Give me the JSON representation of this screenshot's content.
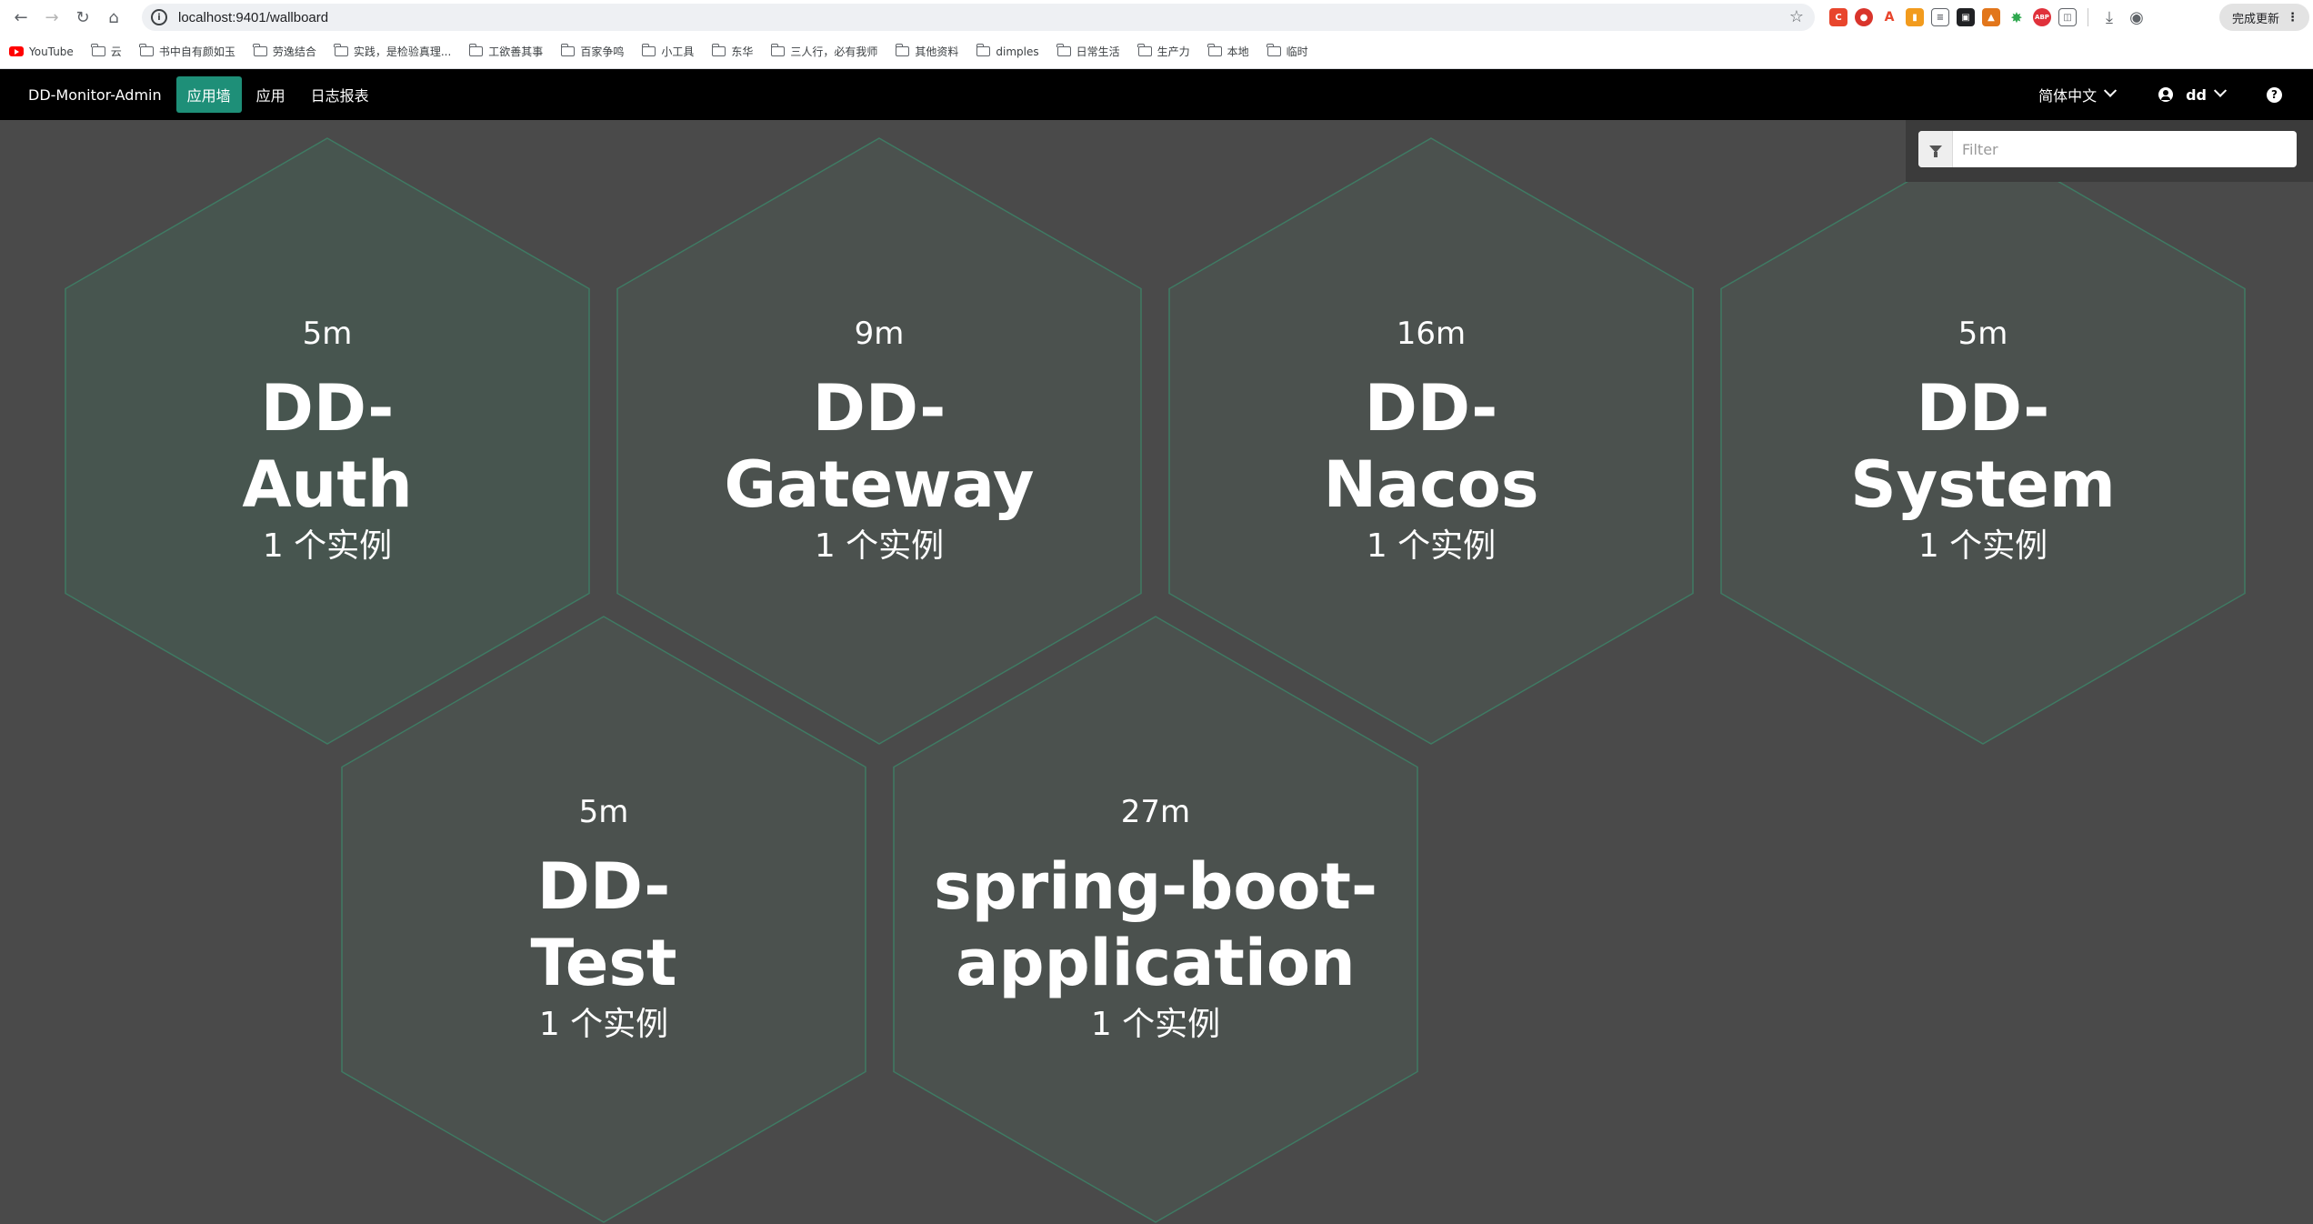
{
  "browser": {
    "url": "localhost:9401/wallboard",
    "update_label": "完成更新",
    "bookmarks": [
      {
        "label": "YouTube",
        "type": "youtube"
      },
      {
        "label": "云",
        "type": "folder"
      },
      {
        "label": "书中自有颜如玉",
        "type": "folder"
      },
      {
        "label": "劳逸结合",
        "type": "folder"
      },
      {
        "label": "实践，是检验真理...",
        "type": "folder"
      },
      {
        "label": "工欲善其事",
        "type": "folder"
      },
      {
        "label": "百家争鸣",
        "type": "folder"
      },
      {
        "label": "小工具",
        "type": "folder"
      },
      {
        "label": "东华",
        "type": "folder"
      },
      {
        "label": "三人行，必有我师",
        "type": "folder"
      },
      {
        "label": "其他资料",
        "type": "folder"
      },
      {
        "label": "dimples",
        "type": "folder"
      },
      {
        "label": "日常生活",
        "type": "folder"
      },
      {
        "label": "生产力",
        "type": "folder"
      },
      {
        "label": "本地",
        "type": "folder"
      },
      {
        "label": "临时",
        "type": "folder"
      }
    ]
  },
  "app_nav": {
    "brand": "DD-Monitor-Admin",
    "links": [
      {
        "label": "应用墙",
        "active": true
      },
      {
        "label": "应用",
        "active": false
      },
      {
        "label": "日志报表",
        "active": false
      }
    ],
    "language": "简体中文",
    "user": "dd",
    "help_icon": "question-circle-icon"
  },
  "filter": {
    "placeholder": "Filter",
    "value": ""
  },
  "theme": {
    "hex_fill": "#4b514e",
    "hex_fill_hover": "#47554f",
    "hex_stroke": "#3f7a63",
    "active_nav": "#1e8f78"
  },
  "applications": [
    {
      "uptime": "5m",
      "name_line1": "DD-",
      "name_line2": "Auth",
      "instances": "1 个实例",
      "highlight": true
    },
    {
      "uptime": "9m",
      "name_line1": "DD-",
      "name_line2": "Gateway",
      "instances": "1 个实例",
      "highlight": false
    },
    {
      "uptime": "16m",
      "name_line1": "DD-",
      "name_line2": "Nacos",
      "instances": "1 个实例",
      "highlight": false
    },
    {
      "uptime": "5m",
      "name_line1": "DD-",
      "name_line2": "System",
      "instances": "1 个实例",
      "highlight": false
    },
    {
      "uptime": "5m",
      "name_line1": "DD-",
      "name_line2": "Test",
      "instances": "1 个实例",
      "highlight": false
    },
    {
      "uptime": "27m",
      "name_line1": "spring-boot-",
      "name_line2": "application",
      "instances": "1 个实例",
      "highlight": false
    }
  ]
}
